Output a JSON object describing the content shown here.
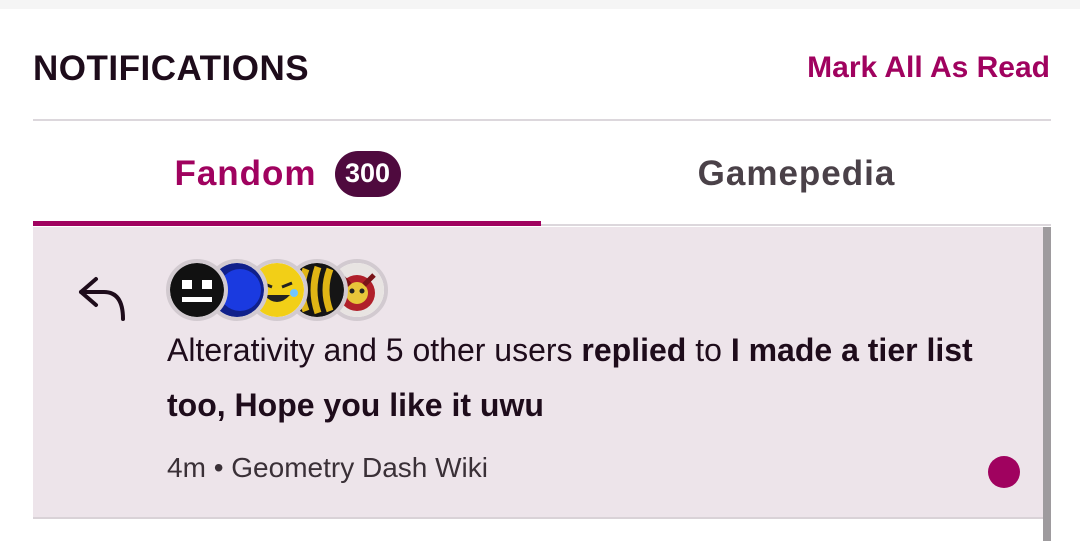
{
  "header": {
    "title": "NOTIFICATIONS",
    "mark_all_read": "Mark All As Read"
  },
  "tabs": [
    {
      "label": "Fandom",
      "badge": "300",
      "active": true
    },
    {
      "label": "Gamepedia",
      "active": false
    }
  ],
  "notification": {
    "icon": "reply-arrow-icon",
    "avatars": [
      "grimace-face-avatar",
      "blue-circle-avatar",
      "laughing-emoji-avatar",
      "yellow-stripes-avatar",
      "red-character-avatar"
    ],
    "actor": "Alterativity and 5 other users",
    "action": "replied",
    "connector": "to",
    "target": "I made a tier list too, Hope you like it uwu",
    "time": "4m",
    "separator": "•",
    "wiki": "Geometry Dash Wiki",
    "unread": true
  },
  "colors": {
    "accent": "#a0025f",
    "badge_bg": "#4f0a3e",
    "unread_row_bg": "#ede4ea",
    "text": "#1e0c1b"
  }
}
